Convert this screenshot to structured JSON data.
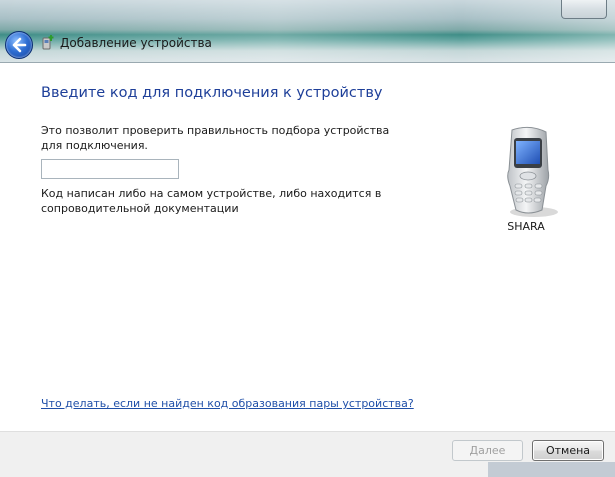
{
  "window": {
    "title": "Добавление устройства"
  },
  "content": {
    "heading": "Введите код для подключения к устройству",
    "description": "Это позволит проверить правильность подбора устройства для подключения.",
    "code_input_value": "",
    "hint": "Код написан либо на самом устройстве, либо находится в сопроводительной документации",
    "help_link": "Что делать, если не найден код образования пары устройства?"
  },
  "device": {
    "name": "SHARA",
    "icon": "mobile-phone-icon"
  },
  "footer": {
    "next_label": "Далее",
    "cancel_label": "Отмена"
  },
  "icons": {
    "back": "back-arrow-icon",
    "title": "bluetooth-device-icon"
  },
  "colors": {
    "heading": "#1e3f99",
    "link": "#1f4fa8",
    "titlebar_accent": "#3f8e87"
  }
}
